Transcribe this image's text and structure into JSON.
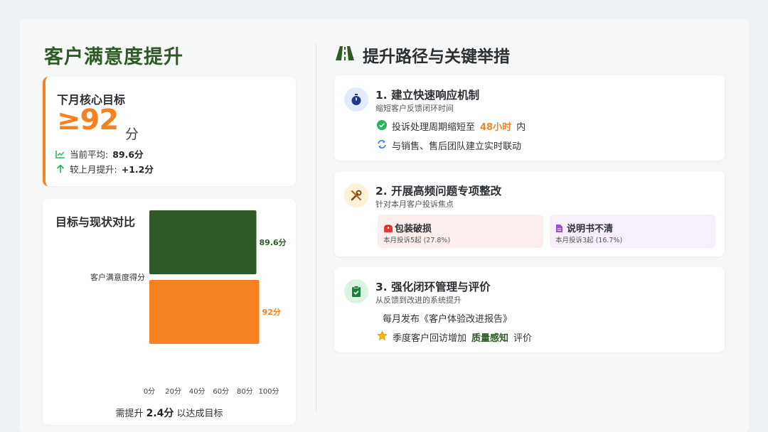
{
  "left": {
    "title": "客户满意度提升",
    "goal": {
      "label": "下月核心目标",
      "value": "≥92",
      "unit": "分",
      "current_label": "当前平均:",
      "current_value": "89.6分",
      "growth_label": "较上月提升:",
      "growth_value": "+1.2分"
    },
    "chart_card": {
      "title": "目标与现状对比",
      "note_prefix": "需提升",
      "note_value": "2.4分",
      "note_suffix": "以达成目标"
    }
  },
  "chart_data": {
    "type": "bar",
    "orientation": "horizontal",
    "categories": [
      "客户满意度得分"
    ],
    "series": [
      {
        "values": [
          89.6
        ],
        "color": "#2d5a27",
        "label": "89.6分"
      },
      {
        "values": [
          92
        ],
        "color": "#f5821f",
        "label": "92分"
      }
    ],
    "xlim": [
      0,
      100
    ],
    "xticks": [
      "0分",
      "20分",
      "40分",
      "60分",
      "80分",
      "100分"
    ],
    "grid": false
  },
  "right": {
    "title": "提升路径与关键举措",
    "steps": [
      {
        "title": "1. 建立快速响应机制",
        "subtitle": "缩短客户反馈闭环时间",
        "bullet1_prefix": "投诉处理周期缩短至",
        "bullet1_highlight": "48小时",
        "bullet1_suffix": "内",
        "bullet2": "与销售、售后团队建立实时联动"
      },
      {
        "title": "2. 开展高频问题专项整改",
        "subtitle": "针对本月客户投诉焦点",
        "issues": [
          {
            "name": "包装破损",
            "detail": "本月投诉5起 (27.8%)"
          },
          {
            "name": "说明书不清",
            "detail": "本月投诉3起 (16.7%)"
          }
        ]
      },
      {
        "title": "3. 强化闭环管理与评价",
        "subtitle": "从反馈到改进的系统提升",
        "bullet1": "每月发布《客户体验改进报告》",
        "bullet2_prefix": "季度客户回访增加",
        "bullet2_highlight": "质量感知",
        "bullet2_suffix": "评价"
      }
    ]
  },
  "colors": {
    "brand_green": "#2d5a27",
    "accent_orange": "#f5821f",
    "check_green": "#22b55a",
    "sync_blue": "#3b82f6"
  },
  "icons": [
    "chart-line-icon",
    "arrow-up-icon",
    "road-icon",
    "stopwatch-icon",
    "tools-icon",
    "clipboard-check-icon",
    "check-circle-icon",
    "sync-icon",
    "box-icon",
    "file-icon",
    "star-icon"
  ]
}
